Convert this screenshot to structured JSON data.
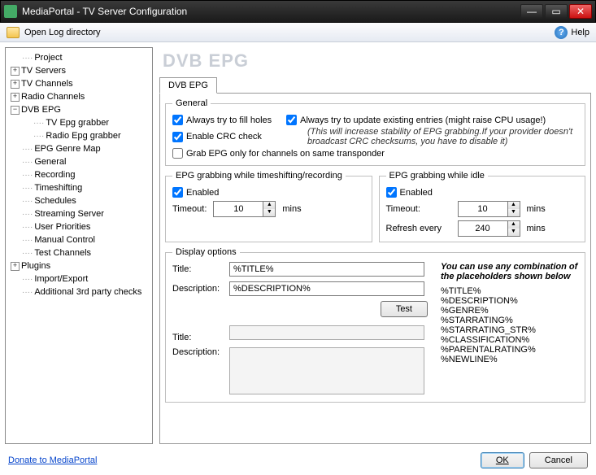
{
  "window": {
    "title": "MediaPortal - TV Server Configuration"
  },
  "toolbar": {
    "open_log": "Open Log directory",
    "help": "Help"
  },
  "tree": {
    "items": [
      {
        "label": "Project",
        "expander": "",
        "indent": 1
      },
      {
        "label": "TV Servers",
        "expander": "+",
        "indent": 0
      },
      {
        "label": "TV Channels",
        "expander": "+",
        "indent": 0
      },
      {
        "label": "Radio Channels",
        "expander": "+",
        "indent": 0
      },
      {
        "label": "DVB EPG",
        "expander": "−",
        "indent": 0
      },
      {
        "label": "TV Epg grabber",
        "expander": "",
        "indent": 2
      },
      {
        "label": "Radio Epg grabber",
        "expander": "",
        "indent": 2
      },
      {
        "label": "EPG Genre Map",
        "expander": "",
        "indent": 1
      },
      {
        "label": "General",
        "expander": "",
        "indent": 1
      },
      {
        "label": "Recording",
        "expander": "",
        "indent": 1
      },
      {
        "label": "Timeshifting",
        "expander": "",
        "indent": 1
      },
      {
        "label": "Schedules",
        "expander": "",
        "indent": 1
      },
      {
        "label": "Streaming Server",
        "expander": "",
        "indent": 1
      },
      {
        "label": "User Priorities",
        "expander": "",
        "indent": 1
      },
      {
        "label": "Manual Control",
        "expander": "",
        "indent": 1
      },
      {
        "label": "Test Channels",
        "expander": "",
        "indent": 1
      },
      {
        "label": "Plugins",
        "expander": "+",
        "indent": 0
      },
      {
        "label": "Import/Export",
        "expander": "",
        "indent": 1
      },
      {
        "label": "Additional 3rd party checks",
        "expander": "",
        "indent": 1
      }
    ]
  },
  "page": {
    "title": "DVB EPG",
    "tab": "DVB EPG"
  },
  "general": {
    "legend": "General",
    "fill_holes": "Always try to fill holes",
    "update_existing": "Always try to update existing entries (might raise CPU usage!)",
    "crc": "Enable CRC check",
    "crc_note": "(This will increase stability of EPG grabbing.If your provider doesn't broadcast CRC checksums, you have to disable it)",
    "same_transponder": "Grab EPG only for channels on same transponder"
  },
  "rec": {
    "legend": "EPG grabbing while timeshifting/recording",
    "enabled": "Enabled",
    "timeout_label": "Timeout:",
    "timeout_value": "10",
    "mins": "mins"
  },
  "idle": {
    "legend": "EPG grabbing while idle",
    "enabled": "Enabled",
    "timeout_label": "Timeout:",
    "timeout_value": "10",
    "refresh_label": "Refresh every",
    "refresh_value": "240",
    "mins": "mins"
  },
  "display": {
    "legend": "Display options",
    "title_label": "Title:",
    "title_value": "%TITLE%",
    "desc_label": "Description:",
    "desc_value": "%DESCRIPTION%",
    "test": "Test",
    "preview_title_label": "Title:",
    "preview_desc_label": "Description:",
    "hint_header": "You can use any combination of the placeholders shown below",
    "placeholders": "%TITLE%\n%DESCRIPTION%\n%GENRE%\n%STARRATING%\n%STARRATING_STR%\n%CLASSIFICATION%\n%PARENTALRATING%\n%NEWLINE%"
  },
  "footer": {
    "donate": "Donate to MediaPortal",
    "ok": "OK",
    "cancel": "Cancel"
  }
}
